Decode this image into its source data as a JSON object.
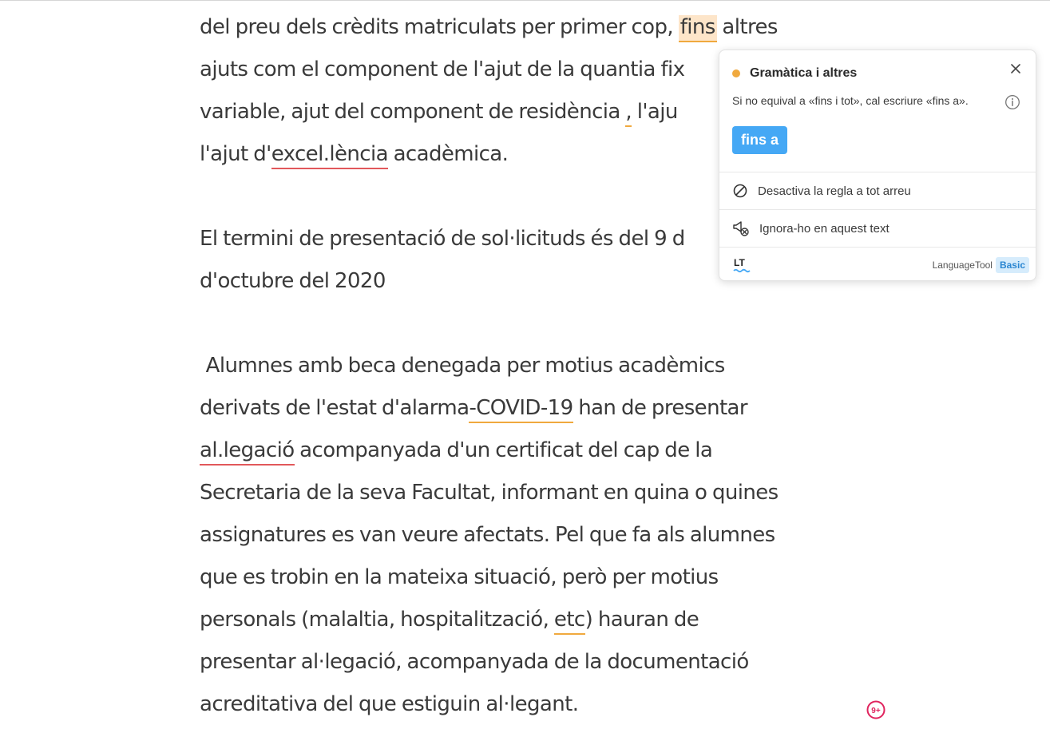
{
  "document": {
    "lines": [
      {
        "a": "del preu dels crèdits matriculats per primer cop, ",
        "fins": "fins",
        "b": " altres"
      },
      {
        "a": "ajuts com el component de l'ajut de la quantia fix"
      },
      {
        "a": "variable, ajut del component de residència ",
        "comma": ",",
        "b": " l'aju"
      },
      {
        "a": "l'ajut d'",
        "error": "excel.lència",
        "b": " acadèmica."
      },
      {
        "a": "El termini de presentació de sol·licituds és del 9 d"
      },
      {
        "a": "d'octubre del 2020"
      },
      {
        "a": " Alumnes amb beca denegada per motius acadèmics"
      },
      {
        "a": "derivats de l'estat d'alarma",
        "flag": "-COVID-19",
        "b": " han de presentar"
      },
      {
        "error": "al.legació",
        "b": " acompanyada d'un certificat del cap de la"
      },
      {
        "a": "Secretaria de la seva Facultat, informant en quina o quines"
      },
      {
        "a": "assignatures es van veure afectats. Pel que fa als alumnes"
      },
      {
        "a": "que es trobin en la mateixa situació, però per motius"
      },
      {
        "a": "personals (malaltia, hospitalització, ",
        "flag": "etc",
        "b": ") hauran de"
      },
      {
        "a": "presentar al·legació, acompanyada de la documentació"
      },
      {
        "a": "acreditativa del que estiguin al·legant."
      }
    ]
  },
  "popup": {
    "category": "Gramàtica i altres",
    "message": "Si no equival a «fins i tot», cal escriure «fins a».",
    "suggestion": "fins a",
    "disable_rule": "Desactiva la regla a tot arreu",
    "ignore_text": "Ignora-ho en aquest text",
    "brand": "LanguageTool",
    "plan": "Basic",
    "logo_text": "LT"
  },
  "notification": {
    "count": "9+"
  },
  "colors": {
    "warning": "#f0a93e",
    "error": "#e2585b",
    "highlight": "#fde5c9",
    "suggestion_bg": "#45a8f5",
    "badge_bg": "#d6ecfc",
    "notification": "#e0245e"
  },
  "icons": {
    "close": "close-icon",
    "info": "info-icon",
    "disable": "circle-slash-icon",
    "ignore": "megaphone-x-icon",
    "logo": "languagetool-logo-icon",
    "notification": "notification-badge-icon"
  }
}
